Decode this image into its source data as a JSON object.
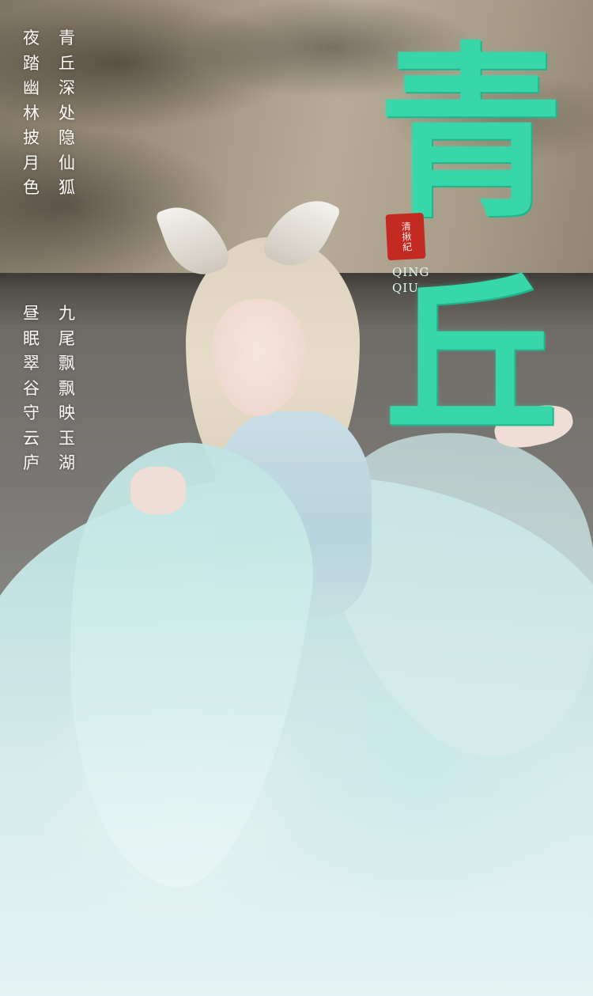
{
  "poem": {
    "column_1": [
      "夜",
      "踏",
      "幽",
      "林",
      "披",
      "月",
      "色"
    ],
    "column_2": [
      "青",
      "丘",
      "深",
      "处",
      "隐",
      "仙",
      "狐"
    ],
    "column_3": [
      "昼",
      "眠",
      "翠",
      "谷",
      "守",
      "云",
      "庐"
    ],
    "column_4": [
      "九",
      "尾",
      "飘",
      "飘",
      "映",
      "玉",
      "湖"
    ]
  },
  "title": {
    "char_1": "青",
    "char_2": "丘",
    "color": "#37d7aa"
  },
  "seal": {
    "text": "清揪紀",
    "color": "#c22a22"
  },
  "romanization": {
    "line_1": "QING",
    "line_2": "QIU"
  }
}
